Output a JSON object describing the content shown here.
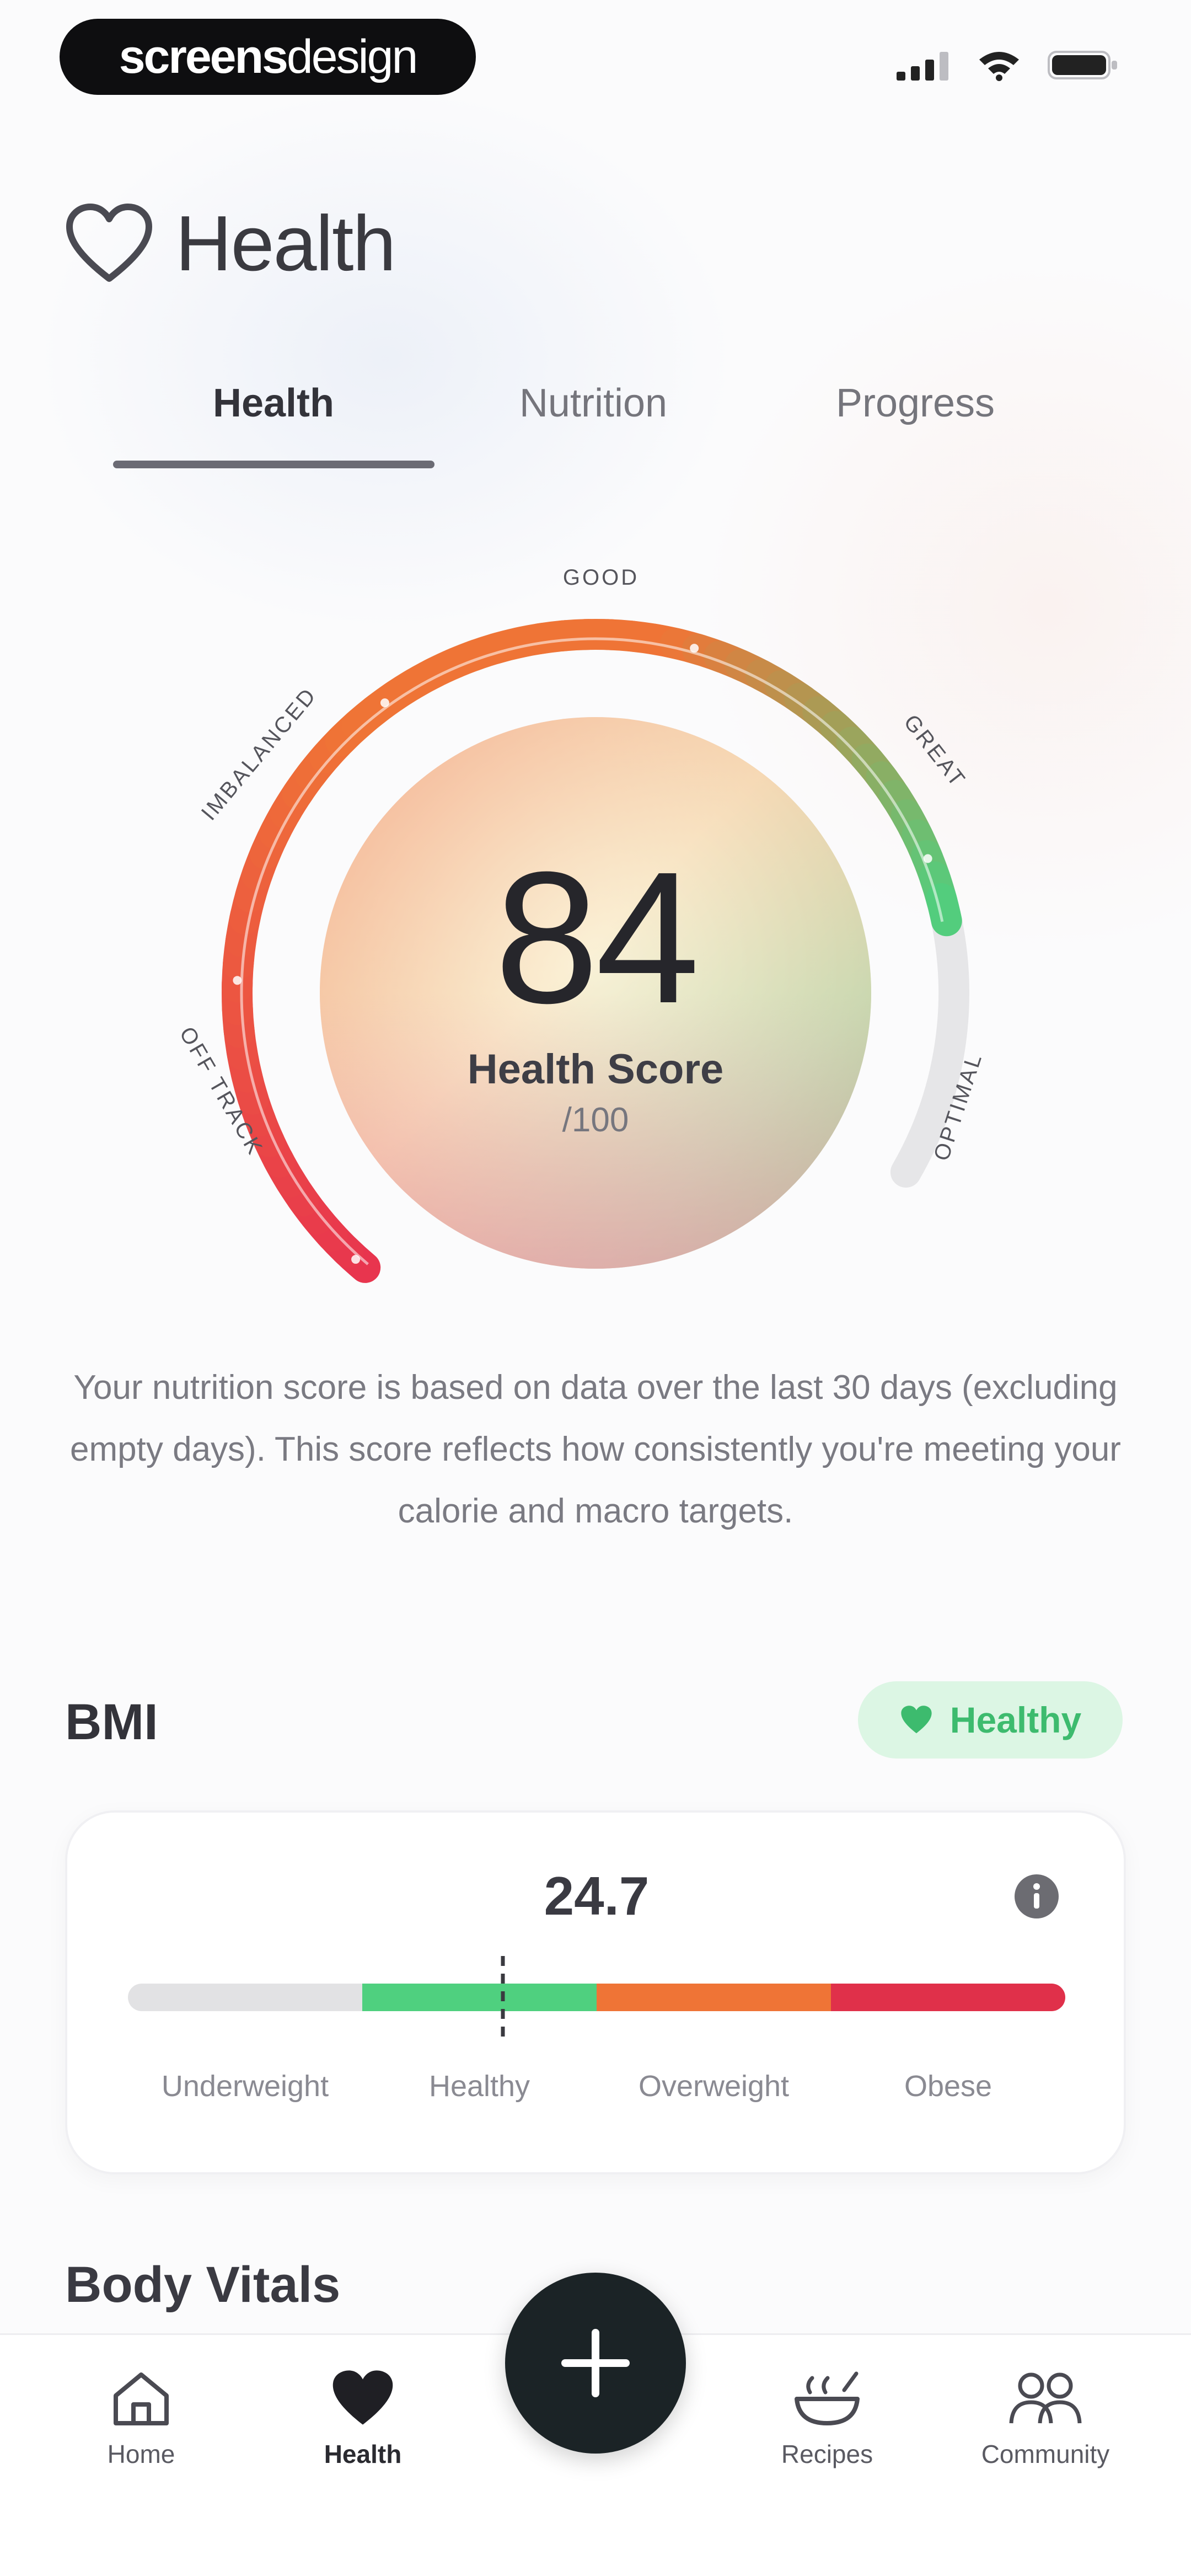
{
  "status_bar": {
    "brand_part1": "screens",
    "brand_part2": "design",
    "icons": [
      "signal-icon",
      "wifi-icon",
      "battery-icon"
    ]
  },
  "header": {
    "title": "Health",
    "icon": "heart-outline-icon"
  },
  "tabs": [
    {
      "label": "Health",
      "active": true
    },
    {
      "label": "Nutrition",
      "active": false
    },
    {
      "label": "Progress",
      "active": false
    }
  ],
  "gauge": {
    "score": "84",
    "label": "Health Score",
    "max": "/100",
    "score_fraction": 0.84,
    "zones": [
      {
        "label": "OFF TRACK"
      },
      {
        "label": "IMBALANCED"
      },
      {
        "label": "GOOD"
      },
      {
        "label": "GREAT"
      },
      {
        "label": "OPTIMAL"
      }
    ],
    "colors": {
      "red": "#e8344e",
      "orange": "#ef7436",
      "green": "#4fd07f",
      "track": "#e6e6e8"
    }
  },
  "description": "Your nutrition score is based on data over the last 30 days (excluding empty days). This score reflects how consistently you're meeting your calorie and macro targets.",
  "bmi": {
    "title": "BMI",
    "badge": "Healthy",
    "value": "24.7",
    "categories": [
      {
        "label": "Underweight",
        "color": "#e2e2e4"
      },
      {
        "label": "Healthy",
        "color": "#4fd07f"
      },
      {
        "label": "Overweight",
        "color": "#ef7436"
      },
      {
        "label": "Obese",
        "color": "#e0304a"
      }
    ],
    "marker_fraction": 0.4
  },
  "vitals": {
    "title": "Body Vitals"
  },
  "nav": {
    "items": [
      {
        "label": "Home",
        "icon": "home-icon"
      },
      {
        "label": "Health",
        "icon": "heart-icon"
      },
      {
        "label": "Recipes",
        "icon": "recipes-icon"
      },
      {
        "label": "Community",
        "icon": "community-icon"
      }
    ],
    "fab_icon": "plus-icon"
  }
}
